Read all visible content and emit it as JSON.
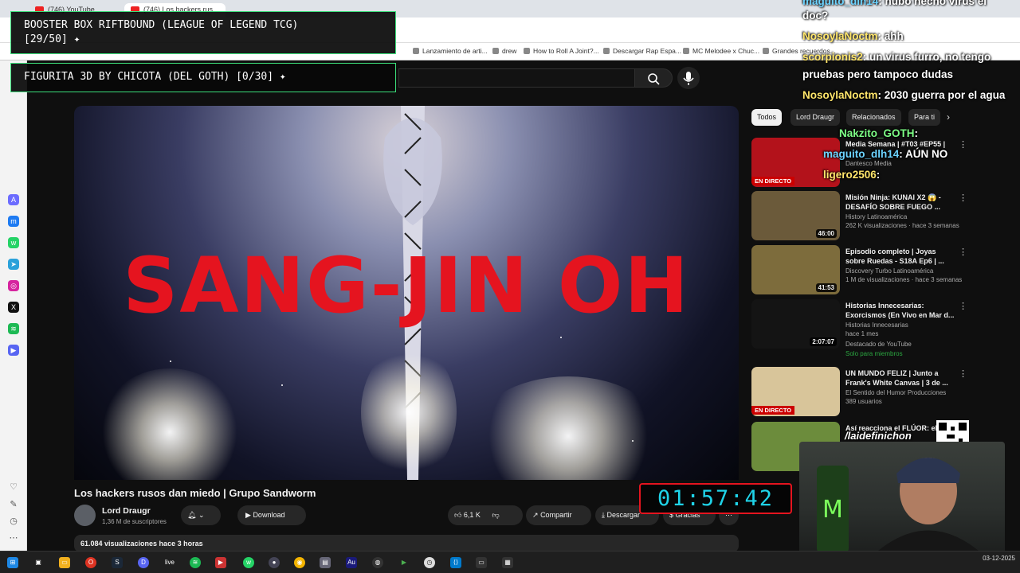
{
  "browser": {
    "tabs": [
      {
        "label": "(746) YouTube"
      },
      {
        "label": "(746) Los hackers rus..."
      }
    ],
    "bookmarks": [
      "Lanzamiento de arti...",
      "drew",
      "How to Roll A Joint?...",
      "Descargar Rap Espa...",
      "MC Melodee x Chuc...",
      "Grandes recuerdos..."
    ]
  },
  "overlays": {
    "goal1": "BOOSTER BOX RIFTBOUND (LEAGUE OF LEGEND TCG)",
    "goal1_count": "[29/50]",
    "goal2": "FIGURITA 3D BY CHICOTA (DEL GOTH) [0/30]",
    "timer": "01:57:42",
    "handle": "/laidefinichon",
    "chat": [
      {
        "user": "maguito_dlh14",
        "text": ": hubo hecho virus el"
      },
      {
        "user": "",
        "text": "doc?"
      },
      {
        "user": "NosoylaNoctm",
        "text": ": ahh"
      },
      {
        "user": "scorpionis2",
        "text": ": un virus furro, no tengo"
      },
      {
        "user": "",
        "text": "pruebas pero tampoco dudas"
      },
      {
        "user": "NosoylaNoctm",
        "text": ": 2030 guerra por el agua"
      },
      {
        "user": "Nakzito_GOTH",
        "text": ":"
      },
      {
        "user": "maguito_dlh14",
        "text": ": AÚN NO"
      },
      {
        "user": "ligero2506",
        "text": ":"
      }
    ]
  },
  "video": {
    "overlay_text": "SANG-JIN OH",
    "title": "Los hackers rusos dan miedo | Grupo Sandworm",
    "channel": "Lord Draugr",
    "subscribers": "1,36 M de suscriptores",
    "download_label": "Download",
    "likes": "6,1 K",
    "share_label": "Compartir",
    "descargar_label": "Descargar",
    "thanks_label": "Gracias",
    "views_line": "61.084 visualizaciones  hace 3 horas"
  },
  "chips": [
    "Todos",
    "Lord Draugr",
    "Relacionados",
    "Para ti"
  ],
  "recommendations": [
    {
      "title": "Media Semana | #T03 #EP55 |",
      "channel": "Dantesco Media",
      "meta": "",
      "duration": "",
      "live": "EN DIRECTO",
      "thumb_color": "#b3121b"
    },
    {
      "title": "Misión Ninja: KUNAI X2 😱 - DESAFÍO SOBRE FUEGO ...",
      "channel": "History Latinoamérica",
      "meta": "262 K visualizaciones · hace 3 semanas",
      "duration": "46:00",
      "live": "",
      "thumb_color": "#6b5a3a"
    },
    {
      "title": "Episodio completo | Joyas sobre Ruedas - S18A Ep6 | ...",
      "channel": "Discovery Turbo Latinoamérica",
      "meta": "1 M de visualizaciones · hace 3 semanas",
      "duration": "41:53",
      "live": "",
      "thumb_color": "#7d6c3c"
    },
    {
      "title": "Historias Innecesarias: Exorcismos (En Vivo en Mar d...",
      "channel": "Historias Innecesarias",
      "meta": "hace 1 mes",
      "duration": "2:07:07",
      "live": "",
      "thumb_color": "#141414"
    },
    {
      "title": "UN MUNDO FELIZ | Junto a Frank's White Canvas | 3 de ...",
      "channel": "El Sentido del Humor Producciones",
      "meta": "389 usuarios",
      "duration": "",
      "live": "EN DIRECTO",
      "thumb_color": "#d8c59a"
    },
    {
      "title": "Así reacciona el FLÚOR: el",
      "channel": "",
      "meta": "",
      "duration": "",
      "live": "",
      "thumb_color": "#6c8c3c"
    }
  ],
  "rec_extra": {
    "featured": "Destacado de YouTube",
    "members": "Solo para miembros"
  },
  "taskbar": {
    "date": "03-12-2025"
  }
}
